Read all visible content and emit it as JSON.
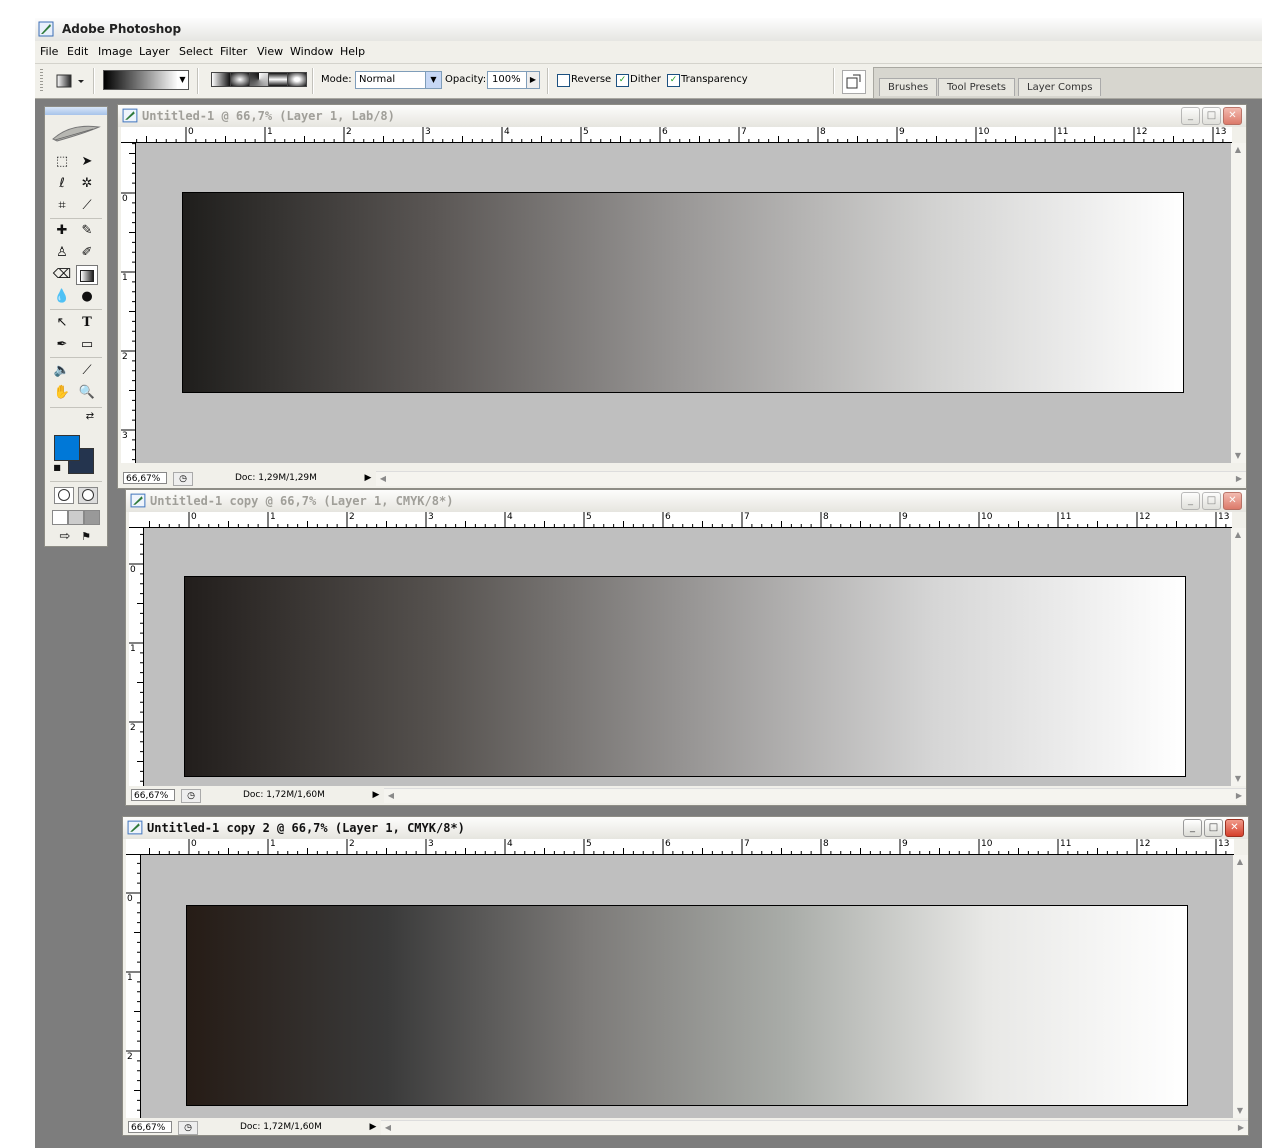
{
  "app": {
    "title": "Adobe Photoshop"
  },
  "menu": [
    "File",
    "Edit",
    "Image",
    "Layer",
    "Select",
    "Filter",
    "View",
    "Window",
    "Help"
  ],
  "options": {
    "mode_label": "Mode:",
    "mode_value": "Normal",
    "opacity_label": "Opacity:",
    "opacity_value": "100%",
    "reverse_label": "Reverse",
    "reverse_checked": false,
    "dither_label": "Dither",
    "dither_checked": true,
    "transparency_label": "Transparency",
    "transparency_checked": true
  },
  "palette_tabs": [
    "Brushes",
    "Tool Presets",
    "Layer Comps"
  ],
  "colors": {
    "foreground": "#0078d7",
    "background": "#24344e"
  },
  "documents": [
    {
      "title": "Untitled-1 @ 66,7% (Layer 1, Lab/8)",
      "active": false,
      "zoom": "66,67%",
      "doc_info": "Doc: 1,29M/1,29M",
      "ruler_h": [
        "0",
        "1",
        "2",
        "3",
        "4",
        "5",
        "6",
        "7",
        "8",
        "9",
        "10",
        "11",
        "12",
        "13"
      ],
      "ruler_v": [
        "0",
        "1",
        "2",
        "3"
      ],
      "gradient_stops": [
        "#1f1e1c",
        "#5a5654",
        "#9a9897",
        "#d2d2d1",
        "#ffffff"
      ]
    },
    {
      "title": "Untitled-1 copy @ 66,7% (Layer 1, CMYK/8*)",
      "active": false,
      "zoom": "66,67%",
      "doc_info": "Doc: 1,72M/1,60M",
      "ruler_h": [
        "0",
        "1",
        "2",
        "3",
        "4",
        "5",
        "6",
        "7",
        "8",
        "9",
        "10",
        "11",
        "12",
        "13"
      ],
      "ruler_v": [
        "0",
        "1",
        "2"
      ],
      "gradient_stops": [
        "#221e1c",
        "#55514e",
        "#969493",
        "#d6d6d6",
        "#ffffff"
      ]
    },
    {
      "title": "Untitled-1 copy 2 @ 66,7% (Layer 1, CMYK/8*)",
      "active": true,
      "zoom": "66,67%",
      "doc_info": "Doc: 1,72M/1,60M",
      "ruler_h": [
        "0",
        "1",
        "2",
        "3",
        "4",
        "5",
        "6",
        "7",
        "8",
        "9",
        "10",
        "11",
        "12",
        "13"
      ],
      "ruler_v": [
        "0",
        "1",
        "2"
      ],
      "gradient_stops": [
        "#261c16",
        "#3a3a3a",
        "#7c7a78",
        "#a9aca8",
        "#e8e8e6",
        "#ffffff"
      ]
    }
  ]
}
